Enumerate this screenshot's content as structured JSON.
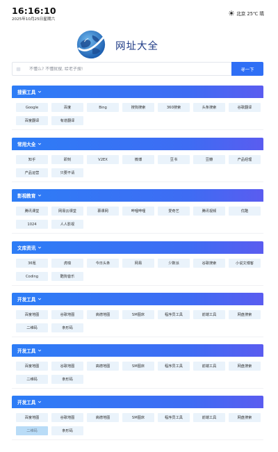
{
  "header": {
    "time": "16:16:10",
    "date": "2025年10月25日星期六",
    "weather": "北京 25℃ 晴",
    "weather_icon": "sun-icon"
  },
  "site": {
    "title": "网址大全",
    "logo_icon": "globe-logo"
  },
  "search": {
    "placeholder": "不懂么? 不懂就搜, 给老子搜!",
    "value": "",
    "button_label": "寻一下"
  },
  "sections": [
    {
      "title": "搜索工具",
      "items": [
        "Google",
        "百度",
        "Bing",
        "搜狗搜索",
        "360搜索",
        "头条搜索",
        "谷歌翻译",
        "百度翻译",
        "有道翻译"
      ]
    },
    {
      "title": "常用大全",
      "items": [
        "知乎",
        "即刻",
        "V2EX",
        "微博",
        "豆书",
        "豆瓣",
        "产品经理",
        "产品运营",
        "只要不请"
      ]
    },
    {
      "title": "影视教育",
      "items": [
        "腾讯课堂",
        "网易云课堂",
        "慕课网",
        "哔哩哔哩",
        "爱奇艺",
        "腾讯视频",
        "优酷",
        "1024",
        "人人影视"
      ]
    },
    {
      "title": "文库资讯",
      "items": [
        "36氪",
        "虎嗅",
        "今日头条",
        "网易",
        "少数派",
        "谷歌搜索",
        "小说文博客",
        "Coding",
        "酷狗音乐"
      ]
    },
    {
      "title": "开发工具",
      "items": [
        "百度地图",
        "谷歌地图",
        "高德地图",
        "SM图床",
        "程序员工具",
        "前端工具",
        "网盘搜索",
        "二维码",
        "条形码"
      ]
    },
    {
      "title": "开发工具",
      "items": [
        "百度地图",
        "谷歌地图",
        "高德地图",
        "SM图床",
        "程序员工具",
        "前端工具",
        "网盘搜索",
        "二维码",
        "条形码"
      ]
    },
    {
      "title": "开发工具",
      "items": [
        "百度地图",
        "谷歌地图",
        "高德地图",
        "SM图床",
        "程序员工具",
        "前端工具",
        "网盘搜索",
        "二维码",
        "条形码"
      ]
    }
  ],
  "colors": {
    "accent": "#2f6ff5",
    "section_header_start": "#2d7df6",
    "section_header_end": "#5a5cf0",
    "chip_bg": "#eaf3fb",
    "chip_active_bg": "#b9dcf7"
  },
  "state": {
    "highlighted_item": "二维码"
  }
}
